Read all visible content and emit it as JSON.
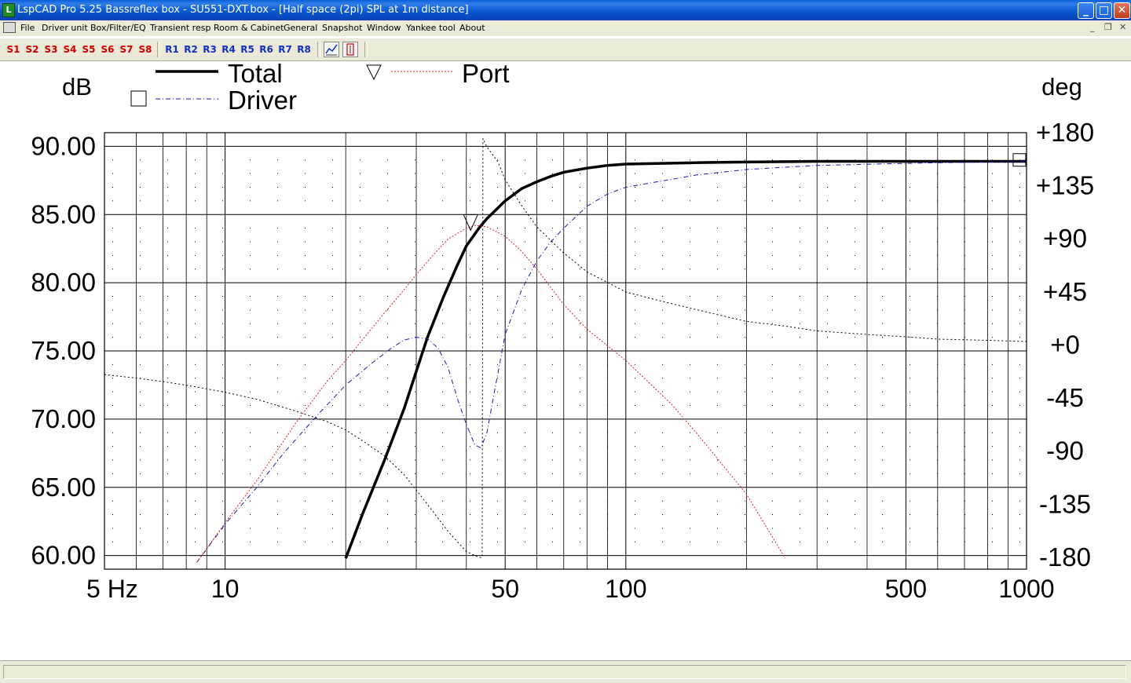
{
  "window": {
    "title": "LspCAD Pro 5.25 Bassreflex box - SU551-DXT.box - [Half space (2pi) SPL at 1m distance]",
    "app_icon_letter": "L",
    "controls": {
      "minimize": "_",
      "maximize": "□",
      "close": "✕"
    }
  },
  "menubar": {
    "items": [
      "File",
      "Driver unit",
      "Box/Filter/EQ",
      "Transient resp",
      "Room & Cabinet",
      "General",
      "Snapshot",
      "Window",
      "Yankee tool",
      "About"
    ],
    "mdi_controls": {
      "minimize": "_",
      "restore": "❐",
      "close": "✕"
    }
  },
  "toolbar": {
    "snapshot_buttons": [
      "S1",
      "S2",
      "S3",
      "S4",
      "S5",
      "S6",
      "S7",
      "S8"
    ],
    "recall_buttons": [
      "R1",
      "R2",
      "R3",
      "R4",
      "R5",
      "R6",
      "R7",
      "R8"
    ],
    "icons": [
      "graph-tool-icon",
      "cursor-tool-icon"
    ]
  },
  "colors": {
    "total": "#000000",
    "driver": "#1a1ab4",
    "port": "#e02020",
    "phase": "#000000",
    "grid": "#000000"
  },
  "chart_data": {
    "type": "line",
    "title": "",
    "xlabel": "",
    "ylabel_left": "dB",
    "ylabel_right": "deg",
    "x_scale": "log",
    "xlim": [
      5,
      1000
    ],
    "ylim": [
      59,
      91
    ],
    "y2lim": [
      -190,
      180
    ],
    "x_tick_labels": [
      {
        "value": 5,
        "label": "5 Hz"
      },
      {
        "value": 10,
        "label": "10"
      },
      {
        "value": 50,
        "label": "50"
      },
      {
        "value": 100,
        "label": "100"
      },
      {
        "value": 500,
        "label": "500"
      },
      {
        "value": 1000,
        "label": "1000"
      }
    ],
    "y_tick_labels": [
      "90.00",
      "85.00",
      "80.00",
      "75.00",
      "70.00",
      "65.00",
      "60.00"
    ],
    "y_tick_values": [
      90,
      85,
      80,
      75,
      70,
      65,
      60
    ],
    "y2_tick_labels": [
      "+180",
      "+135",
      "+90",
      "+45",
      "+0",
      "-45",
      "-90",
      "-135",
      "-180"
    ],
    "y2_tick_values": [
      180,
      135,
      90,
      45,
      0,
      -45,
      -90,
      -135,
      -180
    ],
    "legend": {
      "placement": "top",
      "entries": [
        {
          "label": "Total",
          "style": "solid-thick",
          "marker": "none"
        },
        {
          "label": "Driver",
          "style": "dash-dot",
          "marker": "square"
        },
        {
          "label": "Port",
          "style": "dotted",
          "marker": "triangle-down"
        }
      ]
    },
    "series": [
      {
        "name": "Total",
        "axis": "left",
        "x": [
          20,
          22,
          25,
          28,
          30,
          32,
          35,
          38,
          40,
          43,
          45,
          50,
          55,
          60,
          65,
          70,
          80,
          90,
          100,
          150,
          200,
          300,
          500,
          1000
        ],
        "y": [
          59.8,
          63.0,
          67.0,
          70.8,
          73.5,
          76.0,
          78.9,
          81.3,
          82.7,
          84.0,
          84.7,
          86.0,
          86.9,
          87.4,
          87.8,
          88.1,
          88.4,
          88.6,
          88.7,
          88.8,
          88.85,
          88.9,
          88.9,
          88.9
        ]
      },
      {
        "name": "Driver",
        "axis": "left",
        "x": [
          8.5,
          10,
          12,
          14,
          17,
          20,
          23,
          26,
          28,
          30,
          32,
          34,
          36,
          38,
          40,
          42,
          43.5,
          45,
          47,
          50,
          55,
          60,
          65,
          70,
          80,
          90,
          100,
          150,
          200,
          300,
          500,
          1000
        ],
        "y": [
          59.5,
          62.3,
          65.0,
          67.5,
          70.3,
          72.5,
          74.0,
          75.2,
          75.8,
          76.0,
          75.9,
          75.2,
          73.8,
          71.5,
          69.6,
          68.1,
          67.9,
          69.0,
          72.0,
          76.2,
          79.5,
          81.6,
          83.0,
          84.0,
          85.6,
          86.5,
          87.0,
          87.9,
          88.3,
          88.6,
          88.75,
          88.9
        ]
      },
      {
        "name": "Port",
        "axis": "left",
        "x": [
          8.5,
          10,
          12,
          15,
          18,
          20,
          22,
          25,
          28,
          30,
          33,
          36,
          40,
          42,
          45,
          50,
          55,
          60,
          70,
          80,
          100,
          130,
          150,
          200,
          250
        ],
        "y": [
          59.5,
          62.4,
          65.5,
          69.7,
          72.8,
          74.3,
          75.8,
          77.8,
          79.5,
          80.6,
          82.0,
          83.2,
          84.0,
          84.2,
          84.1,
          83.4,
          82.3,
          81.0,
          78.4,
          76.6,
          74.3,
          71.1,
          69.0,
          64.5,
          59.8
        ]
      },
      {
        "name": "Phase",
        "axis": "right",
        "x": [
          5,
          6,
          7,
          8,
          10,
          12,
          15,
          18,
          20,
          22,
          25,
          28,
          30,
          33,
          36,
          40,
          43,
          43.8,
          44,
          45,
          48,
          50,
          55,
          60,
          70,
          80,
          100,
          120,
          150,
          200,
          250,
          300,
          400,
          500,
          600,
          800,
          1000
        ],
        "y": [
          -25,
          -28,
          -31,
          -34,
          -40,
          -46,
          -56,
          -65,
          -72,
          -81,
          -94,
          -110,
          -123,
          -141,
          -158,
          -175,
          -180,
          -180,
          175,
          168,
          155,
          140,
          118,
          100,
          78,
          62,
          45,
          38,
          30,
          20,
          16,
          12,
          9,
          7,
          5,
          4,
          3
        ]
      }
    ],
    "markers": [
      {
        "series": "Port",
        "shape": "triangle-down",
        "x": 41,
        "y": 84.3
      },
      {
        "series": "Driver",
        "shape": "square",
        "x": 960,
        "y": 89.0
      }
    ]
  }
}
